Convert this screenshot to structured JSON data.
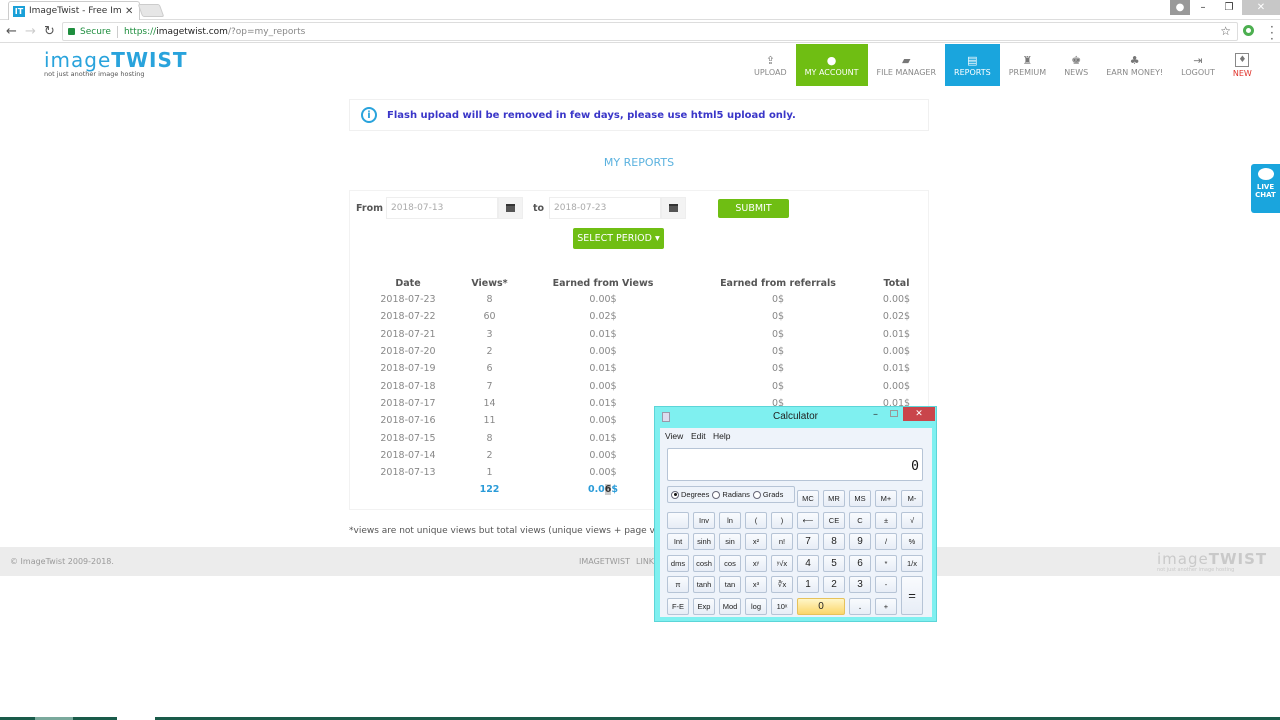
{
  "browser": {
    "tab_title": "ImageTwist - Free Image",
    "favicon_text": "IT",
    "secure_label": "Secure",
    "url_protocol": "https://",
    "url_host": "imagetwist.com",
    "url_path": "/?op=my_reports"
  },
  "site": {
    "logo_light": "image",
    "logo_bold": "TWIST",
    "tagline": "not just another image hosting",
    "nav": [
      {
        "label": "UPLOAD",
        "icon": "upload-icon",
        "glyph": "⇪"
      },
      {
        "label": "MY ACCOUNT",
        "icon": "user-icon",
        "glyph": "●"
      },
      {
        "label": "FILE MANAGER",
        "icon": "folder-icon",
        "glyph": "▰"
      },
      {
        "label": "REPORTS",
        "icon": "document-icon",
        "glyph": "▤"
      },
      {
        "label": "PREMIUM",
        "icon": "award-icon",
        "glyph": "♜"
      },
      {
        "label": "NEWS",
        "icon": "bullhorn-icon",
        "glyph": "♚"
      },
      {
        "label": "EARN MONEY!",
        "icon": "piggy-bank-icon",
        "glyph": "♣"
      },
      {
        "label": "LOGOUT",
        "icon": "logout-icon",
        "glyph": "⇥"
      },
      {
        "label": "NEW",
        "icon": "lightbulb-icon",
        "glyph": "♦"
      }
    ],
    "live_chat": [
      "LIVE",
      "CHAT"
    ]
  },
  "notice": "Flash upload will be removed in few days, please use html5 upload only.",
  "page_title": "MY REPORTS",
  "filter": {
    "from_label": "From",
    "from_value": "2018-07-13",
    "to_label": "to",
    "to_value": "2018-07-23",
    "submit_label": "SUBMIT",
    "select_period_label": "SELECT PERIOD ▾"
  },
  "report": {
    "headers": [
      "Date",
      "Views*",
      "Earned from Views",
      "Earned from referrals",
      "Total"
    ],
    "rows": [
      [
        "2018-07-23",
        "8",
        "0.00$",
        "0$",
        "0.00$"
      ],
      [
        "2018-07-22",
        "60",
        "0.02$",
        "0$",
        "0.02$"
      ],
      [
        "2018-07-21",
        "3",
        "0.01$",
        "0$",
        "0.01$"
      ],
      [
        "2018-07-20",
        "2",
        "0.00$",
        "0$",
        "0.00$"
      ],
      [
        "2018-07-19",
        "6",
        "0.01$",
        "0$",
        "0.01$"
      ],
      [
        "2018-07-18",
        "7",
        "0.00$",
        "0$",
        "0.00$"
      ],
      [
        "2018-07-17",
        "14",
        "0.01$",
        "0$",
        "0.01$"
      ],
      [
        "2018-07-16",
        "11",
        "0.00$",
        "",
        ""
      ],
      [
        "2018-07-15",
        "8",
        "0.01$",
        "",
        ""
      ],
      [
        "2018-07-14",
        "2",
        "0.00$",
        "",
        ""
      ],
      [
        "2018-07-13",
        "1",
        "0.00$",
        "",
        ""
      ]
    ],
    "totals": {
      "views": "122",
      "earned_prefix": "0.0",
      "earned_selected": "6",
      "earned_suffix": "$"
    }
  },
  "footnote": "*views are not unique views but total views (unique views + page views). We",
  "footer": {
    "copyright": "© ImageTwist 2009-2018.",
    "links": [
      "IMAGETWIST",
      "LINK"
    ],
    "logo_light": "image",
    "logo_bold": "TWIST",
    "tagline": "not just another image hosting"
  },
  "calculator": {
    "title": "Calculator",
    "menu": [
      "View",
      "Edit",
      "Help"
    ],
    "display": "0",
    "angle_modes": [
      "Degrees",
      "Radians",
      "Grads"
    ],
    "selected_mode": "Degrees",
    "memory_keys": [
      "MC",
      "MR",
      "MS",
      "M+",
      "M-"
    ],
    "rows": [
      [
        "",
        "Inv",
        "ln",
        "(",
        ")",
        "⟵",
        "CE",
        "C",
        "±",
        "√"
      ],
      [
        "Int",
        "sinh",
        "sin",
        "x²",
        "n!",
        "7",
        "8",
        "9",
        "/",
        "%"
      ],
      [
        "dms",
        "cosh",
        "cos",
        "xʸ",
        "ʸ√x",
        "4",
        "5",
        "6",
        "*",
        "1/x"
      ],
      [
        "π",
        "tanh",
        "tan",
        "x³",
        "∛x",
        "1",
        "2",
        "3",
        "-",
        "="
      ],
      [
        "F-E",
        "Exp",
        "Mod",
        "log",
        "10ˣ",
        "0",
        ".",
        "+"
      ]
    ]
  }
}
